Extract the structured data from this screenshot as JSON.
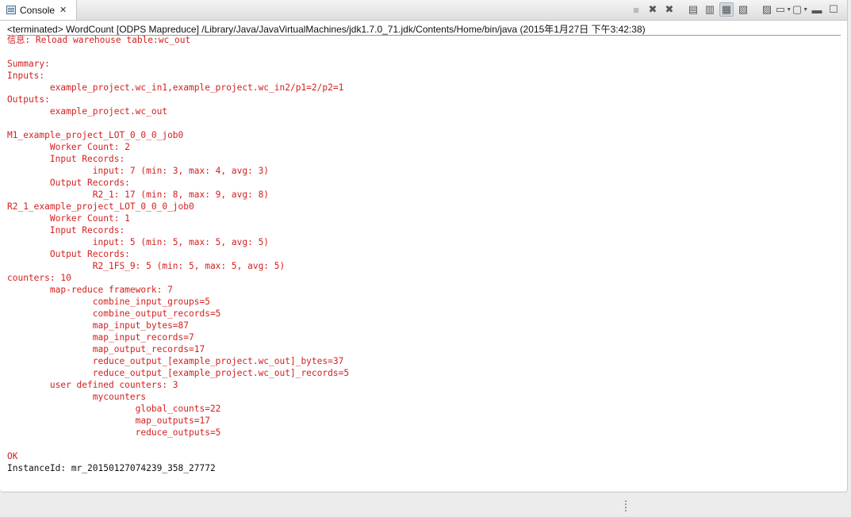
{
  "tab": {
    "title": "Console",
    "close_glyph": "✕",
    "icon": "console-icon"
  },
  "toolbar": {
    "icons": [
      "terminate-icon",
      "remove-launch-icon",
      "remove-all-terminated-icon",
      "clear-console-icon",
      "scroll-lock-icon",
      "word-wrap-icon",
      "show-console-on-output-icon",
      "pin-console-icon",
      "display-selected-console-icon",
      "open-console-icon",
      "minimize-icon",
      "maximize-icon"
    ]
  },
  "status": "<terminated> WordCount [ODPS Mapreduce] /Library/Java/JavaVirtualMachines/jdk1.7.0_71.jdk/Contents/Home/bin/java (2015年1月27日 下午3:42:38)",
  "output_lines": [
    "信息: Reload warehouse table:wc_out",
    "",
    "Summary:",
    "Inputs:",
    "        example_project.wc_in1,example_project.wc_in2/p1=2/p2=1",
    "Outputs:",
    "        example_project.wc_out",
    "",
    "M1_example_project_LOT_0_0_0_job0",
    "        Worker Count: 2",
    "        Input Records:",
    "                input: 7 (min: 3, max: 4, avg: 3)",
    "        Output Records:",
    "                R2_1: 17 (min: 8, max: 9, avg: 8)",
    "R2_1_example_project_LOT_0_0_0_job0",
    "        Worker Count: 1",
    "        Input Records:",
    "                input: 5 (min: 5, max: 5, avg: 5)",
    "        Output Records:",
    "                R2_1FS_9: 5 (min: 5, max: 5, avg: 5)",
    "counters: 10",
    "        map-reduce framework: 7",
    "                combine_input_groups=5",
    "                combine_output_records=5",
    "                map_input_bytes=87",
    "                map_input_records=7",
    "                map_output_records=17",
    "                reduce_output_[example_project.wc_out]_bytes=37",
    "                reduce_output_[example_project.wc_out]_records=5",
    "        user defined counters: 3",
    "                mycounters",
    "                        global_counts=22",
    "                        map_outputs=17",
    "                        reduce_outputs=5",
    "",
    "OK",
    "InstanceId: mr_20150127074239_358_27772"
  ],
  "colors": {
    "stderr": "#d42020",
    "stdout": "#111111"
  }
}
